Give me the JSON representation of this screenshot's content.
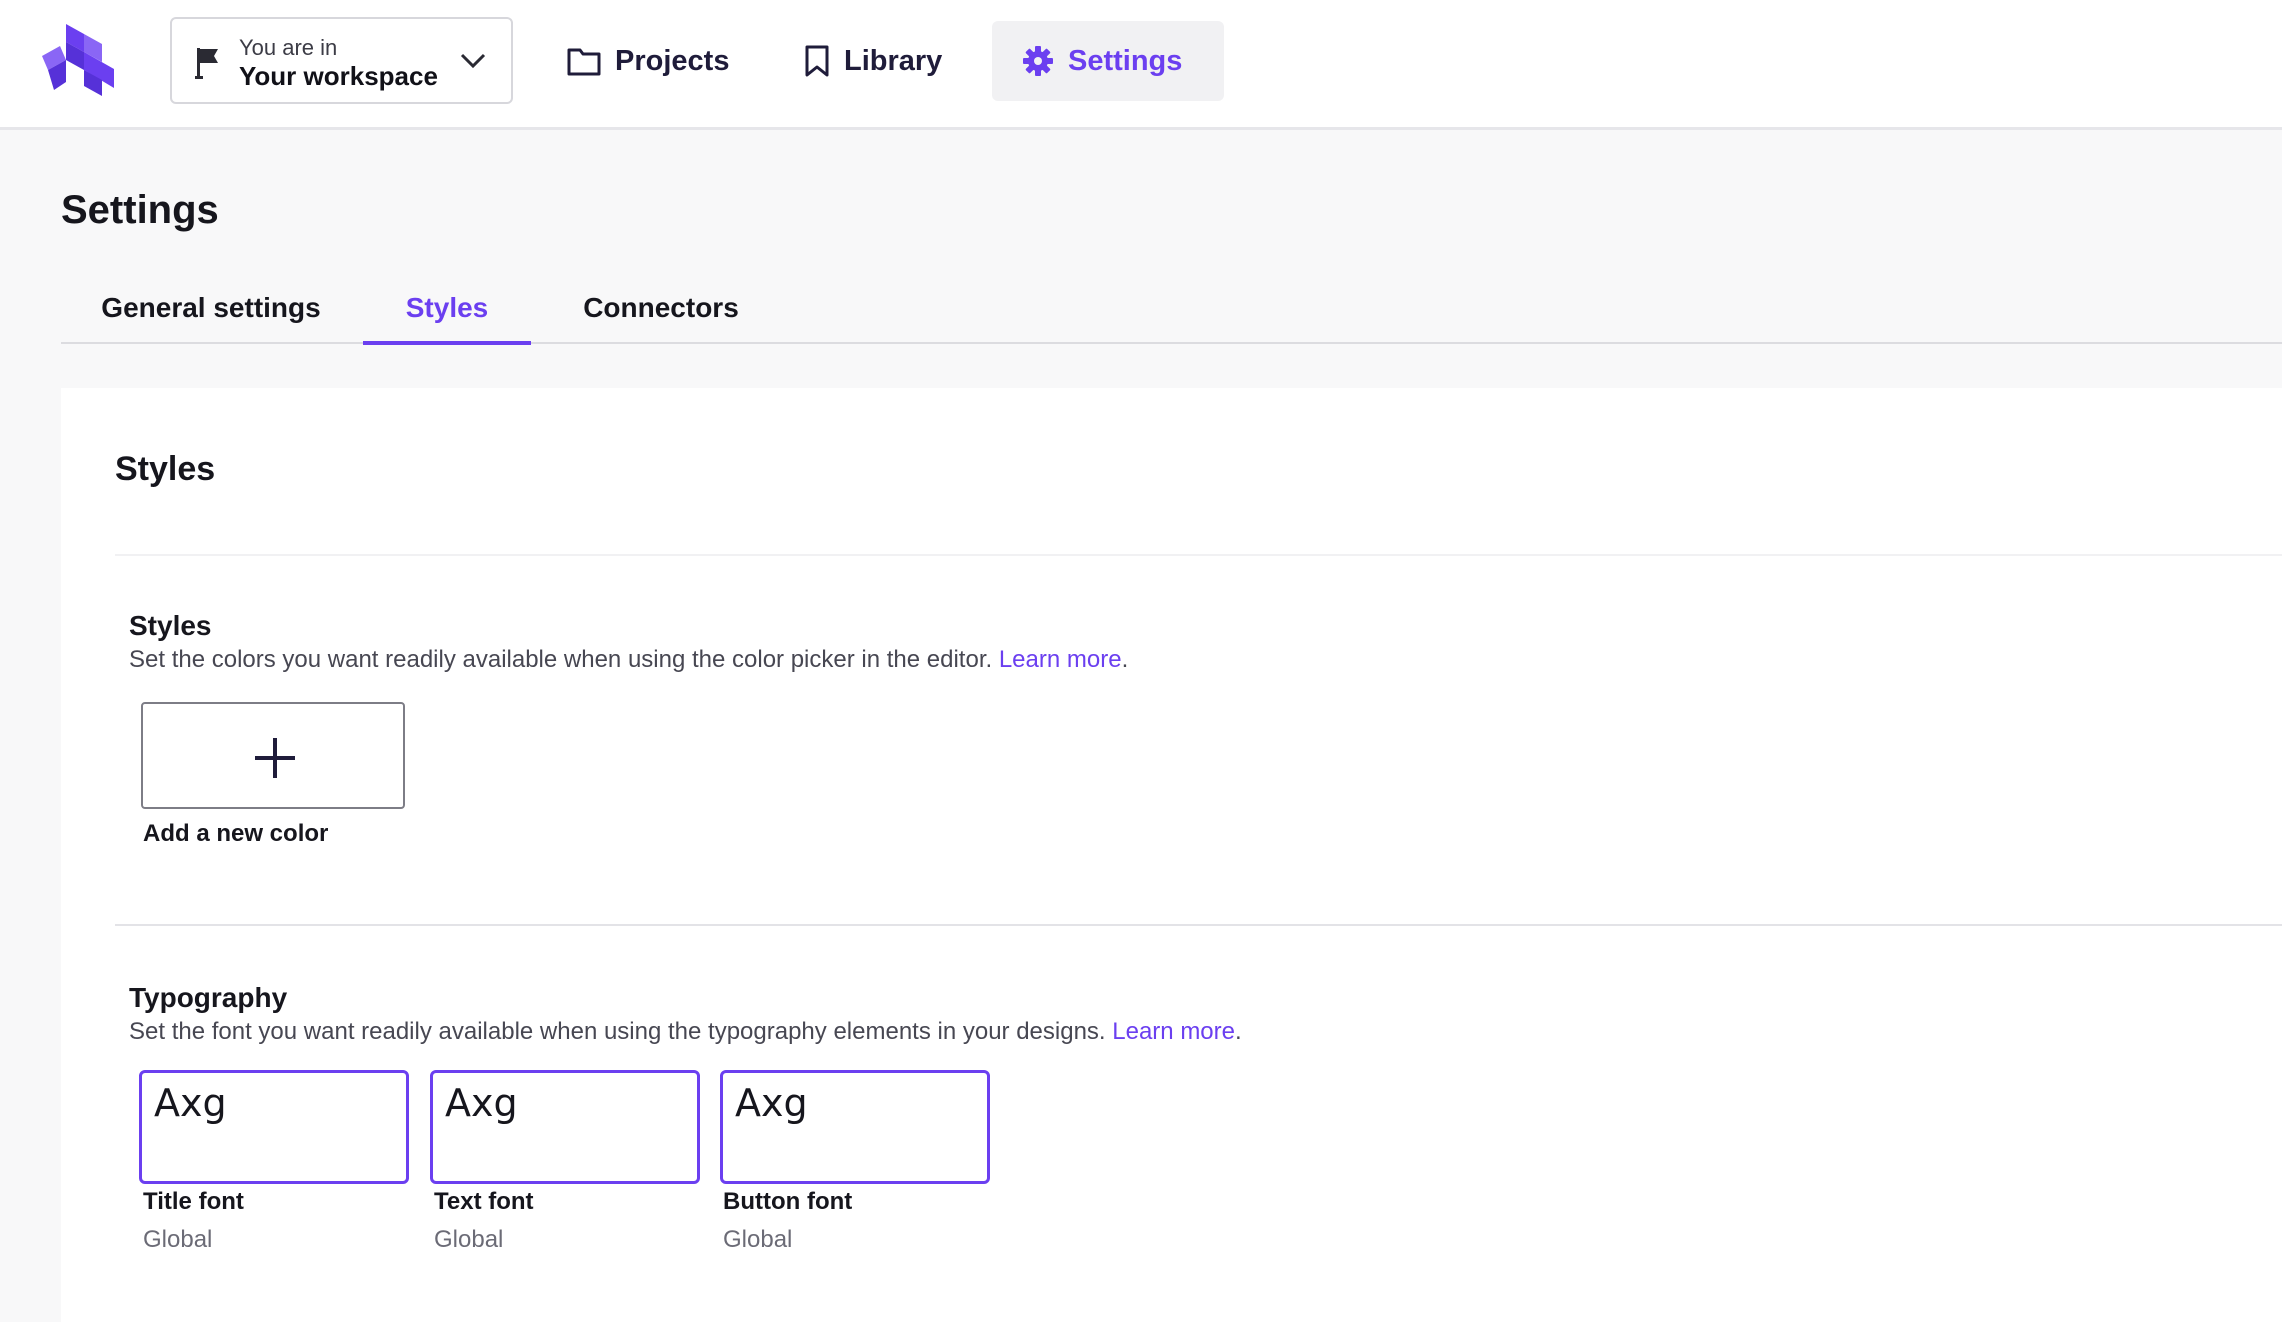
{
  "header": {
    "workspace": {
      "label": "You are in",
      "value": "Your workspace"
    },
    "nav": {
      "projects": "Projects",
      "library": "Library",
      "settings": "Settings"
    }
  },
  "page": {
    "title": "Settings",
    "tabs": [
      "General settings",
      "Styles",
      "Connectors"
    ],
    "active_tab": "Styles"
  },
  "card": {
    "title": "Styles",
    "styles_section": {
      "title": "Styles",
      "description": "Set the colors you want readily available when using the color picker in the editor.",
      "link": "Learn more",
      "add_label": "Add a new color"
    },
    "typography_section": {
      "title": "Typography",
      "description": "Set the font you want readily available when using the typography elements in your designs.",
      "link": "Learn more",
      "fonts": [
        {
          "sample": "Axg",
          "name": "Title font",
          "scope": "Global"
        },
        {
          "sample": "Axg",
          "name": "Text font",
          "scope": "Global"
        },
        {
          "sample": "Axg",
          "name": "Button font",
          "scope": "Global"
        }
      ]
    }
  },
  "colors": {
    "accent": "#6b3ff0",
    "text": "#16161d",
    "background": "#f8f8f9"
  }
}
